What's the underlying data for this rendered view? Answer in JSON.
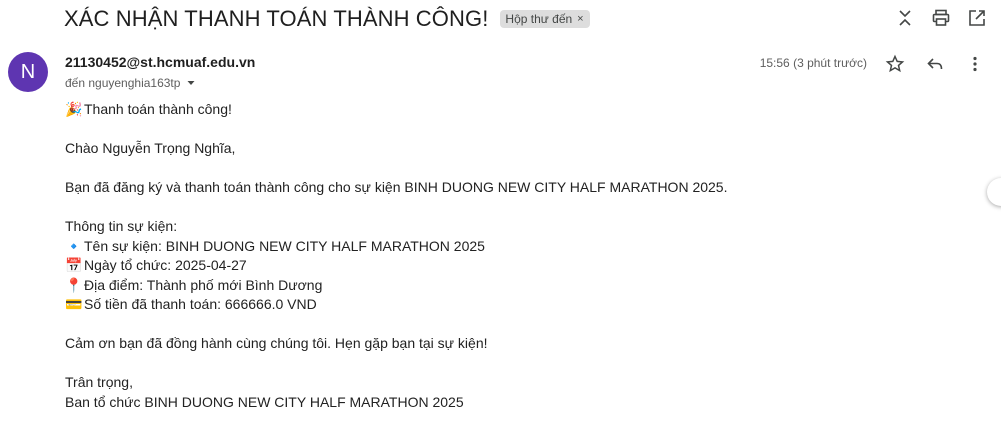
{
  "email": {
    "subject": "XÁC NHẬN THANH TOÁN THÀNH CÔNG!",
    "label": "Hộp thư đến",
    "label_remove": "×",
    "avatar_letter": "N",
    "avatar_color": "#5e35b1",
    "sender": "21130452@st.hcmuaf.edu.vn",
    "recipient": "đến nguyenghia163tp",
    "time": "15:56 (3 phút trước)"
  },
  "body": {
    "line1": "Thanh toán thành công!",
    "line1_emoji": "🎉",
    "greeting": "Chào Nguyễn Trọng Nghĩa,",
    "intro": "Bạn đã đăng ký và thanh toán thành công cho sự kiện BINH DUONG NEW CITY HALF MARATHON 2025.",
    "info_header": "Thông tin sự kiện:",
    "info": [
      {
        "emoji": "🔹",
        "text": "Tên sự kiện: BINH DUONG NEW CITY HALF MARATHON 2025"
      },
      {
        "emoji": "📅",
        "text": "Ngày tổ chức: 2025-04-27"
      },
      {
        "emoji": "📍",
        "text": "Địa điểm: Thành phố mới Bình Dương"
      },
      {
        "emoji": "💳",
        "text": "Số tiền đã thanh toán: 666666.0 VND"
      }
    ],
    "thanks": "Cảm ơn bạn đã đồng hành cùng chúng tôi. Hẹn gặp bạn tại sự kiện!",
    "signoff": "Trân trọng,",
    "signature": "Ban tổ chức BINH DUONG NEW CITY HALF MARATHON 2025"
  },
  "icons": {
    "collapse": "collapse-icon",
    "print": "print-icon",
    "open_new_window": "open-in-new-window-icon",
    "star": "star-icon",
    "reply": "reply-icon",
    "more": "more-vert-icon",
    "recipient_details": "chevron-down-icon"
  }
}
